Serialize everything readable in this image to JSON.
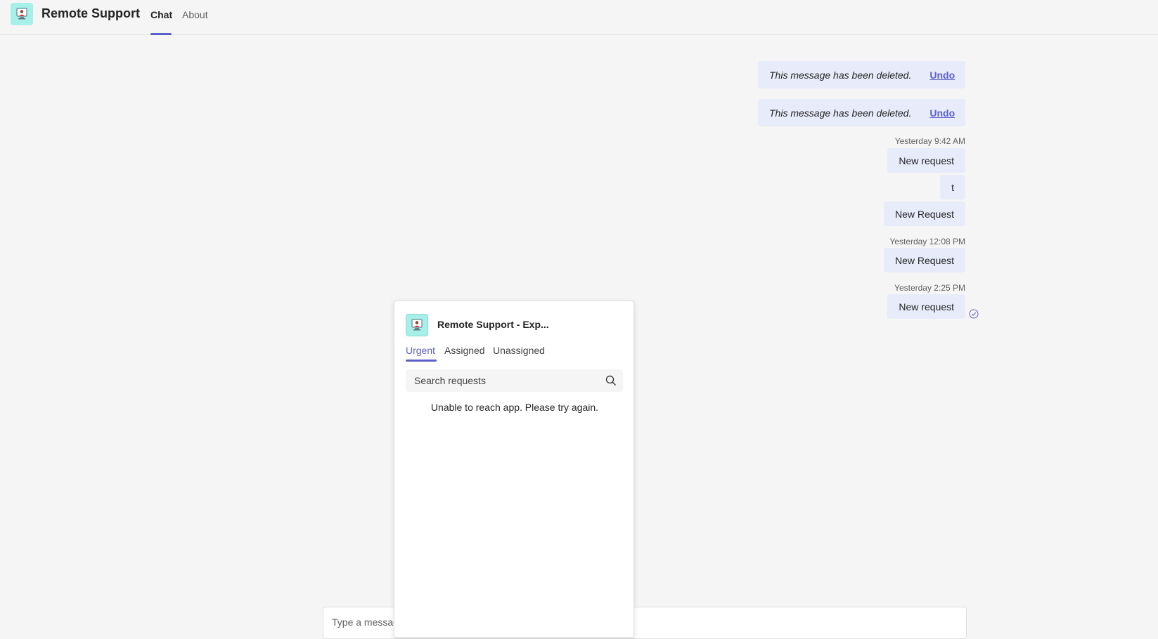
{
  "header": {
    "app_title": "Remote Support",
    "tabs": [
      {
        "label": "Chat",
        "active": true
      },
      {
        "label": "About",
        "active": false
      }
    ]
  },
  "messages": {
    "deleted": [
      {
        "text": "This message has been deleted.",
        "action": "Undo"
      },
      {
        "text": "This message has been deleted.",
        "action": "Undo"
      }
    ],
    "groups": [
      {
        "timestamp": "Yesterday 9:42 AM",
        "bubbles": [
          "New request",
          "t",
          "New Request"
        ]
      },
      {
        "timestamp": "Yesterday 12:08 PM",
        "bubbles": [
          "New Request"
        ]
      },
      {
        "timestamp": "Yesterday 2:25 PM",
        "bubbles": [
          "New request"
        ]
      }
    ]
  },
  "popup": {
    "title": "Remote Support - Exp...",
    "tabs": [
      "Urgent",
      "Assigned",
      "Unassigned"
    ],
    "active_tab": "Urgent",
    "search_placeholder": "Search requests",
    "error": "Unable to reach app. Please try again."
  },
  "compose": {
    "placeholder": "Type a message"
  },
  "colors": {
    "accent": "#5b5fc7",
    "bubble": "#e8ebfa",
    "app_icon_bg": "#a7f0ea"
  }
}
